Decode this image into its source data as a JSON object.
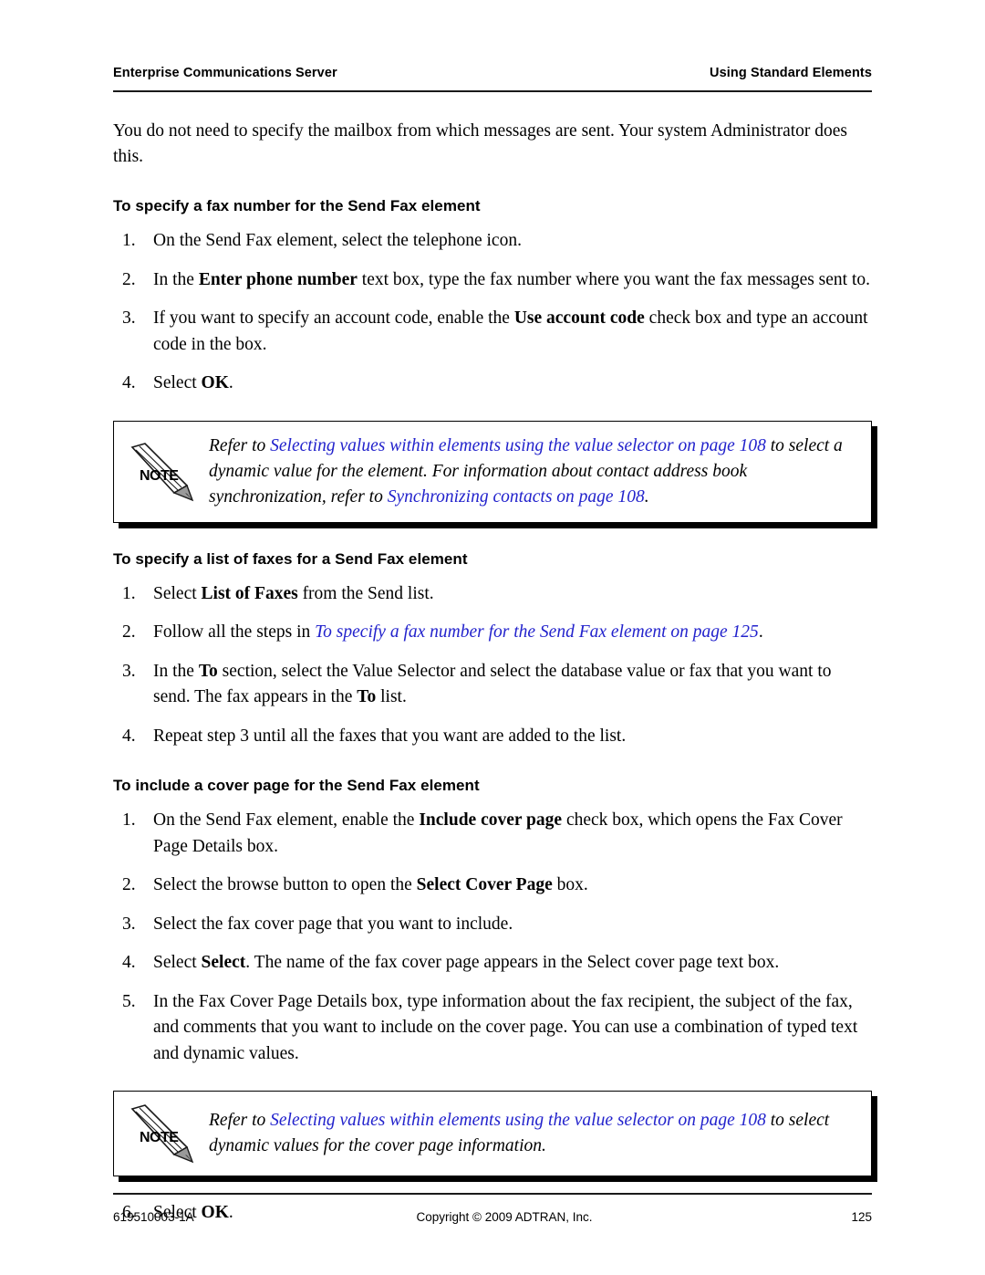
{
  "header": {
    "left": "Enterprise Communications Server",
    "right": "Using Standard Elements"
  },
  "intro": {
    "paragraph": "You do not need to specify the mailbox from which messages are sent. Your system Administrator does this."
  },
  "sections": [
    {
      "heading": "To specify a fax number for the Send Fax element",
      "steps": [
        {
          "num": "1.",
          "p1": "On the Send Fax element, select the telephone icon."
        },
        {
          "num": "2.",
          "p1": "In the ",
          "bold": "Enter phone number",
          "p2": " text box, type the fax number where you want the fax messages sent to."
        },
        {
          "num": "3.",
          "p1": "If you want to specify an account code, enable the ",
          "bold": "Use account code",
          "p2": " check box and type an account code in the box."
        },
        {
          "num": "4.",
          "p1": "Select ",
          "bold": "OK",
          "p2": "."
        }
      ]
    },
    {
      "heading": "To specify a list of faxes for a Send Fax element",
      "steps": [
        {
          "num": "1.",
          "p1": "Select ",
          "bold": "List of Faxes",
          "p2": " from the Send list."
        },
        {
          "num": "2.",
          "p1": "Follow all the steps in ",
          "link": "To specify a fax number for the Send Fax element on page 125",
          "p2": "."
        },
        {
          "num": "3.",
          "p1": "In the ",
          "bold": "To",
          "p2": " section, select the Value Selector and select the database value or fax that you want to send. The fax appears in the ",
          "bold2": "To",
          "p3": " list."
        },
        {
          "num": "4.",
          "p1": "Repeat step 3 until all the faxes that you want are added to the list."
        }
      ]
    },
    {
      "heading": "To include a cover page for the Send Fax element",
      "steps": [
        {
          "num": "1.",
          "p1": "On the Send Fax element, enable the ",
          "bold": "Include cover page",
          "p2": " check box, which opens the Fax Cover Page Details box."
        },
        {
          "num": "2.",
          "p1": "Select the browse button to open the ",
          "bold": "Select Cover Page",
          "p2": " box."
        },
        {
          "num": "3.",
          "p1": "Select the fax cover page that you want to include."
        },
        {
          "num": "4.",
          "p1": "Select ",
          "bold": "Select",
          "p2": ". The name of the fax cover page appears in the Select cover page text box."
        },
        {
          "num": "5.",
          "p1": "In the Fax Cover Page Details box, type information about the fax recipient, the subject of the fax, and comments that you want to include on the cover page. You can use a combination of typed text and dynamic values."
        }
      ],
      "final_step": {
        "num": "6.",
        "p1": "Select ",
        "bold": "OK",
        "p2": "."
      }
    }
  ],
  "notes": [
    {
      "icon_label": "NOTE",
      "pre": "Refer to ",
      "link1": "Selecting values within elements using the value selector on page 108",
      "mid": " to select a dynamic value for the element. For information about contact address book synchronization, refer to ",
      "link2": "Synchronizing contacts on page 108",
      "post": "."
    },
    {
      "icon_label": "NOTE",
      "pre": "Refer to ",
      "link1": "Selecting values within elements using the value selector on page 108",
      "mid": " to select dynamic values for the cover page information.",
      "link2": "",
      "post": ""
    }
  ],
  "footer": {
    "left": "619510003-1A",
    "center": "Copyright © 2009 ADTRAN, Inc.",
    "right": "125"
  },
  "colors": {
    "link": "#2222cc",
    "rule": "#1a1a1a",
    "text": "#000000"
  }
}
